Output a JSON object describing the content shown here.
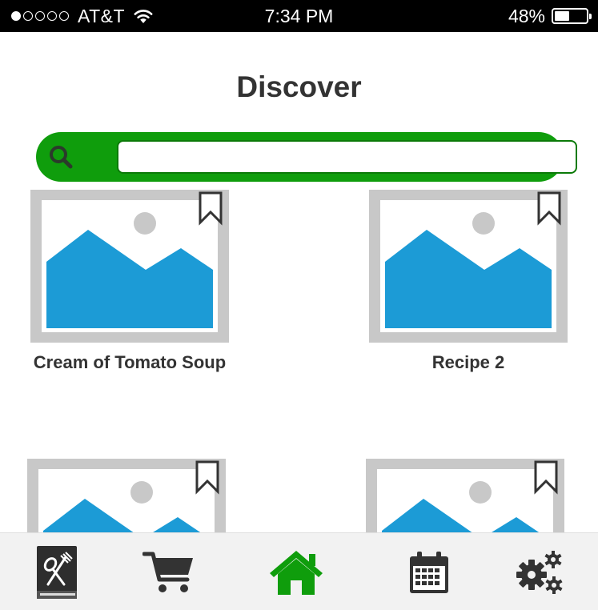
{
  "status_bar": {
    "carrier": "AT&T",
    "time": "7:34 PM",
    "battery": "48%",
    "battery_level": 0.48,
    "signal_bars_filled": 1,
    "signal_bars_total": 5
  },
  "header": {
    "title": "Discover"
  },
  "search": {
    "placeholder": "",
    "value": "",
    "accent_color": "#0f9d0c"
  },
  "recipes": [
    {
      "title": "Cream of Tomato Soup",
      "image": "image-placeholder-icon",
      "bookmark": "bookmark-icon"
    },
    {
      "title": "Recipe 2",
      "image": "image-placeholder-icon",
      "bookmark": "bookmark-icon"
    },
    {
      "title": "",
      "image": "image-placeholder-icon",
      "bookmark": "bookmark-icon"
    },
    {
      "title": "",
      "image": "image-placeholder-icon",
      "bookmark": "bookmark-icon"
    }
  ],
  "tab_bar": {
    "active": "home",
    "active_color": "#0f9d0c",
    "items": [
      {
        "id": "recipes",
        "icon": "recipe-book-icon"
      },
      {
        "id": "cart",
        "icon": "shopping-cart-icon"
      },
      {
        "id": "home",
        "icon": "home-icon"
      },
      {
        "id": "calendar",
        "icon": "calendar-icon"
      },
      {
        "id": "settings",
        "icon": "gears-icon"
      }
    ]
  }
}
